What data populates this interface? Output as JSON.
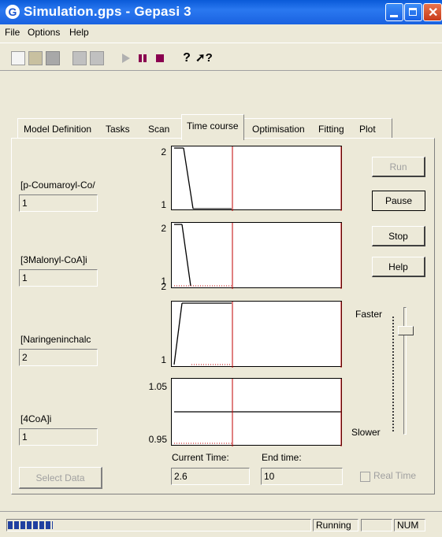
{
  "window": {
    "title": "Simulation.gps - Gepasi 3",
    "app_icon": "gepasi-logo-icon"
  },
  "menu": {
    "items": [
      "File",
      "Options",
      "Help"
    ]
  },
  "toolbar": {
    "icons": [
      "new-icon",
      "open-icon",
      "save-icon",
      "load-icon",
      "export-icon",
      "play-icon",
      "pause-icon",
      "stop-icon",
      "help-icon",
      "context-help-icon"
    ]
  },
  "tabs": [
    "Model Definition",
    "Tasks",
    "Scan",
    "Time course",
    "Optimisation",
    "Fitting",
    "Plot"
  ],
  "active_tab": "Time course",
  "variables": [
    {
      "label": "[p-Coumaroyl-Co/",
      "value": "1"
    },
    {
      "label": "[3Malonyl-CoA]i",
      "value": "1"
    },
    {
      "label": "[Naringeninchalc",
      "value": "2"
    },
    {
      "label": "[4CoA]i",
      "value": "1"
    }
  ],
  "select_data_label": "Select Data",
  "plots": [
    {
      "ymax": "2",
      "ymin": "1"
    },
    {
      "ymax": "2",
      "ymin": "1"
    },
    {
      "ymax": "2",
      "ymin": "1"
    },
    {
      "ymax": "1.05",
      "ymin": "0.95"
    }
  ],
  "current_time": {
    "label": "Current Time:",
    "value": "2.6"
  },
  "end_time": {
    "label": "End time:",
    "value": "10"
  },
  "buttons": {
    "run": "Run",
    "pause": "Pause",
    "stop": "Stop",
    "help": "Help"
  },
  "speed": {
    "faster": "Faster",
    "slower": "Slower"
  },
  "real_time_label": "Real Time",
  "status": {
    "progress": 0.15,
    "state": "Running",
    "num": "NUM"
  },
  "colors": {
    "titlebar": "#1a62e0",
    "marker": "#c00000",
    "face": "#ece9d8",
    "progress": "#2040a0"
  }
}
